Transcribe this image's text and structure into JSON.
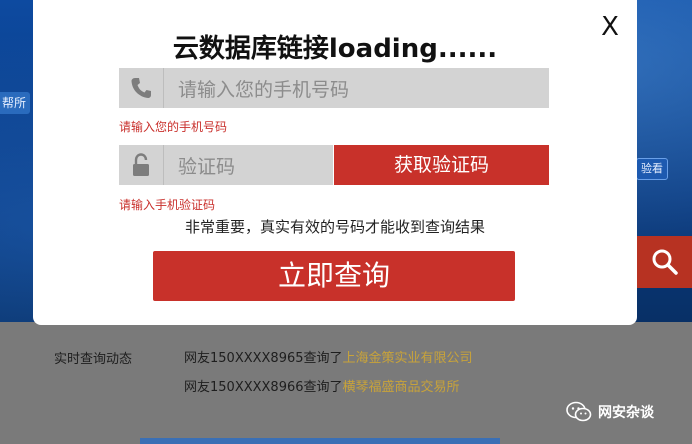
{
  "background": {
    "left_tag": "帮所",
    "right_tag": "验看",
    "realtime_label": "实时查询动态",
    "rows": [
      {
        "prefix": "网友150XXXX8965查询了",
        "company": "上海金策实业有限公司"
      },
      {
        "prefix": "网友150XXXX8966查询了",
        "company": "横琴福盛商品交易所"
      }
    ],
    "search_icon": "search-icon"
  },
  "modal": {
    "close_label": "X",
    "title": "云数据库链接loading......",
    "phone_placeholder": "请输入您的手机号码",
    "phone_error": "请输入您的手机号码",
    "code_placeholder": "验证码",
    "get_code_label": "获取验证码",
    "code_error": "请输入手机验证码",
    "notice": "非常重要，真实有效的号码才能收到查询结果",
    "query_label": "立即查询"
  },
  "watermark": {
    "text": "网安杂谈",
    "icon": "wechat-icon"
  },
  "colors": {
    "accent_red": "#c8312a",
    "error_red": "#c9302c",
    "field_gray": "#d3d3d3",
    "company_gold": "#c8a33a"
  }
}
